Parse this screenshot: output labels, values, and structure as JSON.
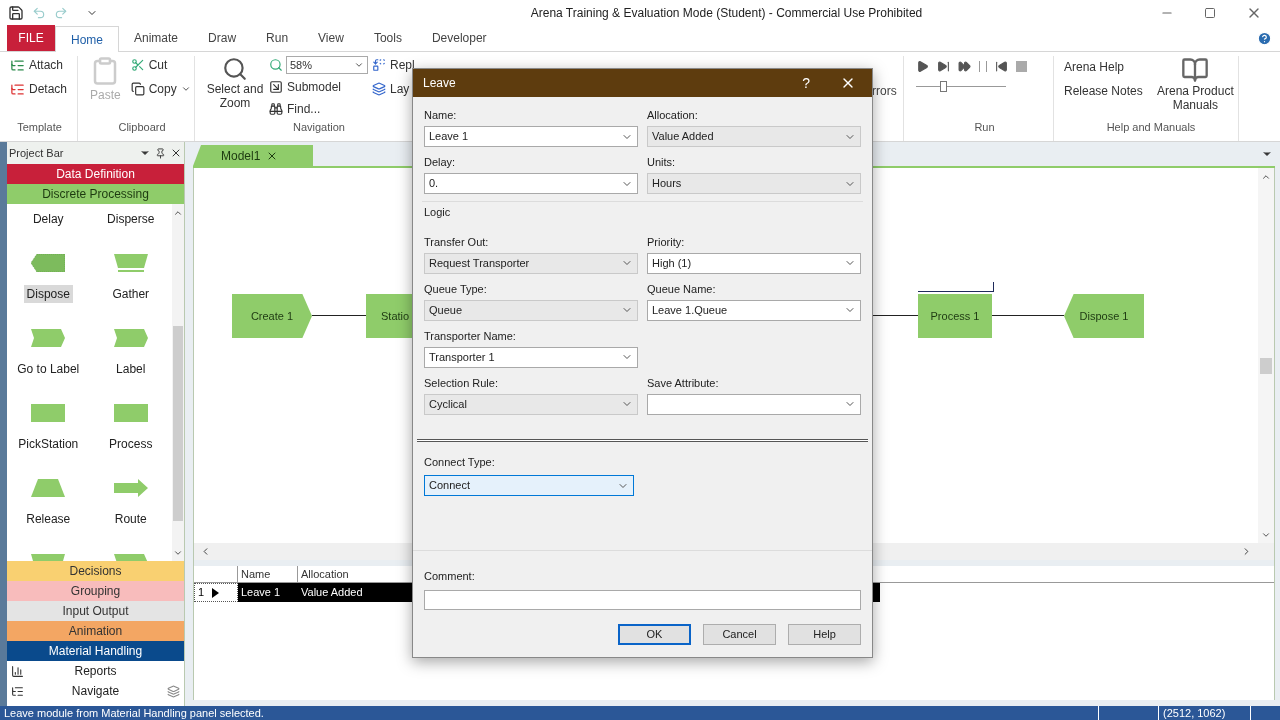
{
  "window": {
    "title": "Arena Training & Evaluation Mode (Student) - Commercial Use Prohibited"
  },
  "menu_tabs": [
    {
      "label": "FILE",
      "kind": "file",
      "selected": false
    },
    {
      "label": "Home",
      "kind": "tab",
      "selected": true
    },
    {
      "label": "Animate",
      "kind": "tab",
      "selected": false
    },
    {
      "label": "Draw",
      "kind": "tab",
      "selected": false
    },
    {
      "label": "Run",
      "kind": "tab",
      "selected": false
    },
    {
      "label": "View",
      "kind": "tab",
      "selected": false
    },
    {
      "label": "Tools",
      "kind": "tab",
      "selected": false
    },
    {
      "label": "Developer",
      "kind": "tab",
      "selected": false
    }
  ],
  "ribbon": {
    "template": {
      "label": "Template",
      "attach": "Attach",
      "detach": "Detach"
    },
    "clipboard": {
      "label": "Clipboard",
      "paste": "Paste",
      "cut": "Cut",
      "copy": "Copy"
    },
    "navigation": {
      "label": "Navigation",
      "select_zoom": "Select and Zoom",
      "zoom": "58%",
      "submodel": "Submodel",
      "find": "Find...",
      "replace": "Repl",
      "layers": "Lay"
    },
    "errors_fragment": "rrors",
    "run": {
      "label": "Run",
      "speed": {
        "level": 0.3
      }
    },
    "help": {
      "label": "Help and Manuals",
      "arena_help": "Arena Help",
      "release_notes": "Release Notes",
      "manuals": "Arena Product Manuals"
    }
  },
  "project_bar": {
    "title": "Project Bar",
    "top_panels": [
      {
        "label": "Data Definition",
        "color": "#c8203a"
      },
      {
        "label": "Discrete Processing",
        "color": "#8fcc6a"
      }
    ],
    "modules": [
      {
        "label": "Delay",
        "selected": false
      },
      {
        "label": "Disperse",
        "selected": false
      },
      {
        "label": "Dispose",
        "kind": "dispose",
        "selected": true
      },
      {
        "label": "Gather",
        "kind": "gather",
        "selected": false
      },
      {
        "label": "Go to Label",
        "kind": "tag",
        "selected": false
      },
      {
        "label": "Label",
        "kind": "tag",
        "selected": false
      },
      {
        "label": "PickStation",
        "kind": "rect",
        "selected": false
      },
      {
        "label": "Process",
        "kind": "rect",
        "selected": false
      },
      {
        "label": "Release",
        "kind": "trapezoid",
        "selected": false
      },
      {
        "label": "Route",
        "kind": "arrow",
        "selected": false
      },
      {
        "kind": "gather"
      },
      {
        "kind": "tag"
      }
    ],
    "bottom_panels": [
      {
        "label": "Decisions",
        "color": "#f9d071"
      },
      {
        "label": "Grouping",
        "color": "#f8bcbc"
      },
      {
        "label": "Input Output",
        "color": "#e4e4e4"
      },
      {
        "label": "Animation",
        "color": "#f3a663"
      },
      {
        "label": "Material Handling",
        "color": "#0a4a8c"
      }
    ],
    "links": [
      {
        "label": "Reports",
        "kind": "reports"
      },
      {
        "label": "Navigate",
        "kind": "navigate"
      }
    ]
  },
  "model_tab": {
    "label": "Model1"
  },
  "canvas": {
    "modules": [
      {
        "label": "Create 1",
        "kind": "create"
      },
      {
        "label": "Statio",
        "kind": "station"
      },
      {
        "label": "Process 1",
        "kind": "process"
      },
      {
        "label": "Dispose 1",
        "kind": "dispose"
      }
    ]
  },
  "table": {
    "columns": [
      "Name",
      "Allocation"
    ],
    "rows": [
      {
        "index": "1",
        "cells": [
          "Leave 1",
          "Value Added"
        ],
        "selected": true
      }
    ]
  },
  "dialog": {
    "title": "Leave",
    "help": "?",
    "rows": [
      [
        {
          "label": "Name:",
          "value": "Leave 1",
          "kind": "combo"
        },
        {
          "label": "Allocation:",
          "value": "Value Added",
          "kind": "list"
        }
      ],
      [
        {
          "label": "Delay:",
          "value": "0.",
          "kind": "combo"
        },
        {
          "label": "Units:",
          "value": "Hours",
          "kind": "list"
        }
      ]
    ],
    "logic": {
      "label": "Logic",
      "rows": [
        [
          {
            "label": "Transfer Out:",
            "value": "Request Transporter",
            "kind": "list"
          },
          {
            "label": "Priority:",
            "value": "High (1)",
            "kind": "combo"
          }
        ],
        [
          {
            "label": "Queue Type:",
            "value": "Queue",
            "kind": "list"
          },
          {
            "label": "Queue Name:",
            "value": "Leave 1.Queue",
            "kind": "combo"
          }
        ],
        [
          {
            "label": "Transporter Name:",
            "value": "Transporter 1",
            "kind": "combo"
          }
        ],
        [
          {
            "label": "Selection Rule:",
            "value": "Cyclical",
            "kind": "list"
          },
          {
            "label": "Save Attribute:",
            "kind": "combo"
          }
        ]
      ]
    },
    "connect": {
      "label": "Connect Type:",
      "value": "Connect",
      "focused": true
    },
    "comment": {
      "label": "Comment:"
    },
    "buttons": [
      {
        "label": "OK",
        "default": true
      },
      {
        "label": "Cancel",
        "default": false
      },
      {
        "label": "Help",
        "default": false
      }
    ]
  },
  "status_bar": {
    "message": "Leave module from Material Handling panel selected.",
    "coordinates": "(2512, 1062)"
  }
}
